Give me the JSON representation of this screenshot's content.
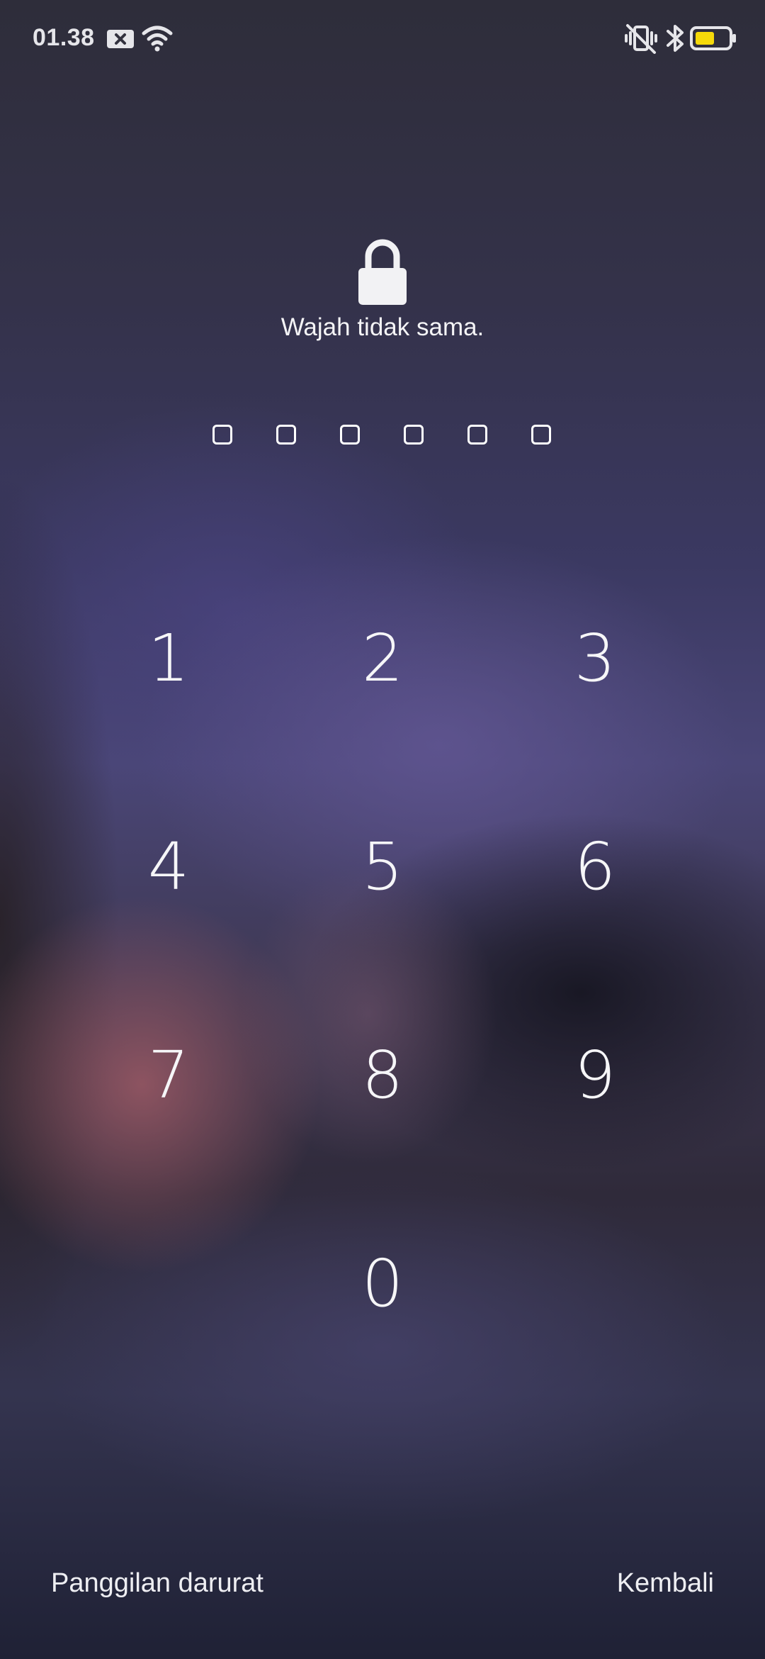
{
  "status_bar": {
    "time": "01.38",
    "icons": [
      "notification-x-icon",
      "wifi-icon",
      "vibrate-off-icon",
      "bluetooth-icon",
      "battery-icon"
    ],
    "battery_color": "#f5d90a"
  },
  "lock_screen": {
    "icon": "lock-icon",
    "message": "Wajah tidak sama.",
    "pin_length": 6,
    "pin_entered": 0
  },
  "keypad": {
    "keys": [
      "1",
      "2",
      "3",
      "4",
      "5",
      "6",
      "7",
      "8",
      "9",
      "0"
    ]
  },
  "actions": {
    "emergency_call": "Panggilan darurat",
    "back": "Kembali"
  }
}
